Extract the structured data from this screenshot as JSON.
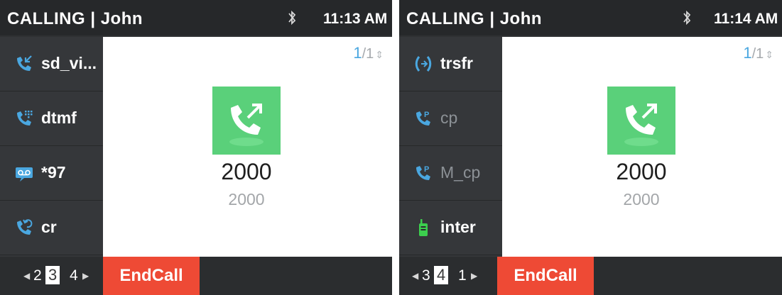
{
  "screens": [
    {
      "title": "CALLING | John",
      "time": "11:13 AM",
      "page": {
        "current": "1",
        "total": "/1"
      },
      "softkeys": [
        {
          "label": "sd_vi...",
          "icon": "phone-incoming-icon",
          "dimmed": false
        },
        {
          "label": "dtmf",
          "icon": "dialpad-phone-icon",
          "dimmed": false
        },
        {
          "label": "*97",
          "icon": "voicemail-icon",
          "dimmed": false
        },
        {
          "label": "cr",
          "icon": "phone-callback-icon",
          "dimmed": false
        }
      ],
      "contact": {
        "name": "2000",
        "number": "2000"
      },
      "pager": {
        "prev": "2",
        "current": "3",
        "next": "4"
      },
      "endcall": "EndCall"
    },
    {
      "title": "CALLING | John",
      "time": "11:14 AM",
      "page": {
        "current": "1",
        "total": "/1"
      },
      "softkeys": [
        {
          "label": "trsfr",
          "icon": "transfer-icon",
          "dimmed": false
        },
        {
          "label": "cp",
          "icon": "park-phone-icon",
          "dimmed": true
        },
        {
          "label": "M_cp",
          "icon": "park-phone-icon",
          "dimmed": true
        },
        {
          "label": "inter",
          "icon": "walkie-talkie-icon",
          "dimmed": false
        }
      ],
      "contact": {
        "name": "2000",
        "number": "2000"
      },
      "pager": {
        "prev": "3",
        "current": "4",
        "next": "1"
      },
      "endcall": "EndCall"
    }
  ],
  "colors": {
    "accent_blue": "#4aa7e0",
    "avatar_green": "#5ad07a",
    "endcall_red": "#ee4a35",
    "intercom_green": "#3ccf4e"
  }
}
